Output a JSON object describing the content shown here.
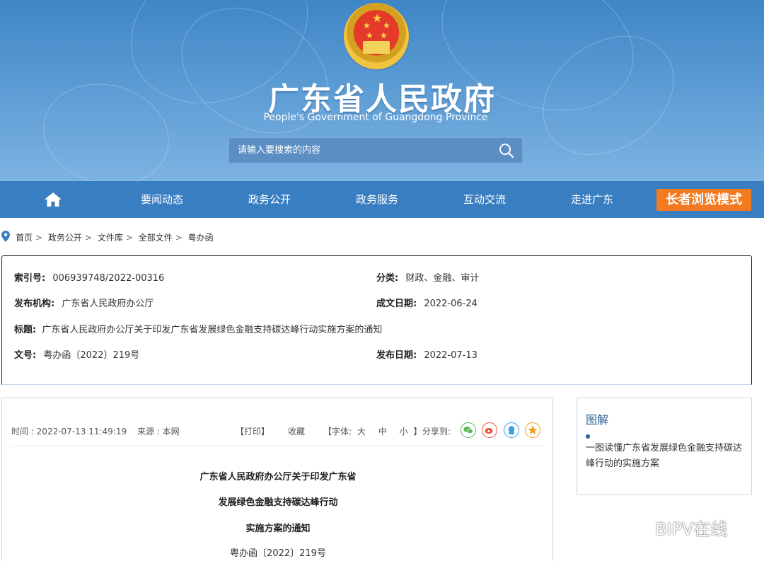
{
  "header": {
    "site_title": "广东省人民政府",
    "site_subtitle": "People's Government of Guangdong Province",
    "search_placeholder": "请输入要搜索的内容"
  },
  "nav": {
    "items": [
      "要闻动态",
      "政务公开",
      "政务服务",
      "互动交流",
      "走进广东"
    ],
    "elder_mode": "长者浏览模式"
  },
  "breadcrumb": [
    "首页",
    "政务公开",
    "文件库",
    "全部文件",
    "粤办函"
  ],
  "info": {
    "index_no_label": "索引号:",
    "index_no": "006939748/2022-00316",
    "category_label": "分类:",
    "category": "财政、金融、审计",
    "publisher_label": "发布机构:",
    "publisher": "广东省人民政府办公厅",
    "created_label": "成文日期:",
    "created": "2022-06-24",
    "title_label": "标题:",
    "title": "广东省人民政府办公厅关于印发广东省发展绿色金融支持碳达峰行动实施方案的通知",
    "doc_no_label": "文号:",
    "doc_no": "粤办函〔2022〕219号",
    "publish_label": "发布日期:",
    "publish": "2022-07-13"
  },
  "article": {
    "time": "时间 : 2022-07-13 11:49:19",
    "source": "来源 : 本网",
    "print": "【打印】",
    "favorite": "收藏",
    "font_prefix": "【字体:",
    "font_large": "大",
    "font_medium": "中",
    "font_small": "小",
    "font_suffix": "】",
    "share_label": "分享到:",
    "title_lines": [
      "广东省人民政府办公厅关于印发广东省",
      "发展绿色金融支持碳达峰行动",
      "实施方案的通知"
    ],
    "doc_no": "粤办函〔2022〕219号"
  },
  "side": {
    "title": "图解",
    "link": "一图读懂广东省发展绿色金融支持碳达峰行动的实施方案"
  },
  "watermark": {
    "text": "BIPV在线"
  },
  "colors": {
    "nav_bg": "#3a7ec2",
    "elder_btn": "#f47a20",
    "side_title": "#2b5f9a"
  }
}
